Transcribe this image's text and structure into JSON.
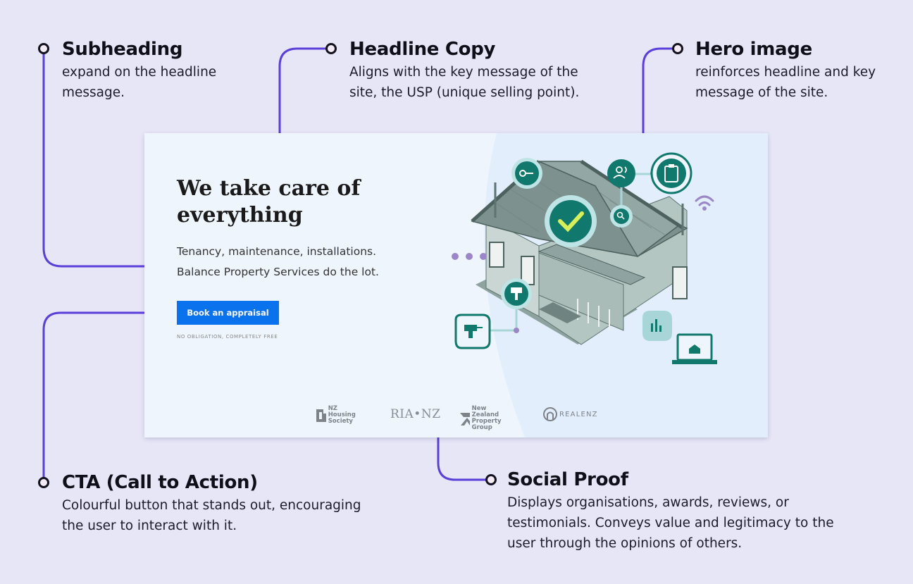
{
  "annotations": {
    "subheading": {
      "title": "Subheading",
      "desc_line1": "expand on the headline",
      "desc_line2": "message."
    },
    "headline": {
      "title": "Headline Copy",
      "desc_line1": "Aligns with the key message of the",
      "desc_line2": "site, the USP (unique selling point)."
    },
    "hero": {
      "title": "Hero image",
      "desc_line1": "reinforces headline and key",
      "desc_line2": "message of the site."
    },
    "cta": {
      "title": "CTA (Call to Action)",
      "desc_line1": "Colourful button that stands out, encouraging",
      "desc_line2": "the user to interact with it."
    },
    "social": {
      "title": "Social Proof",
      "desc_line1": "Displays organisations, awards, reviews, or",
      "desc_line2": "testimonials. Conveys value and legitimacy to the",
      "desc_line3": "user through the opinions of others."
    }
  },
  "mockup": {
    "headline_line1": "We take care of",
    "headline_line2": "everything",
    "subheading_line1": "Tenancy, maintenance, installations.",
    "subheading_line2": "Balance Property Services do the lot.",
    "cta_label": "Book an appraisal",
    "cta_note": "NO OBLIGATION, COMPLETELY FREE",
    "logos": {
      "nz_housing_line1": "NZ Housing",
      "nz_housing_line2": "Society",
      "ria": "RIA•NZ",
      "nzpg_line1": "New Zealand",
      "nzpg_line2": "Property Group",
      "realenz": "REALENZ"
    }
  },
  "colors": {
    "connector": "#5b3fd9",
    "background": "#e6e6f7",
    "cta": "#0a72ec",
    "teal": "#11786e"
  },
  "icons": [
    "key-icon",
    "users-icon",
    "clipboard-icon",
    "check-icon",
    "search-icon",
    "wifi-icon",
    "paint-roller-icon",
    "drill-icon",
    "bar-chart-icon",
    "laptop-icon"
  ]
}
